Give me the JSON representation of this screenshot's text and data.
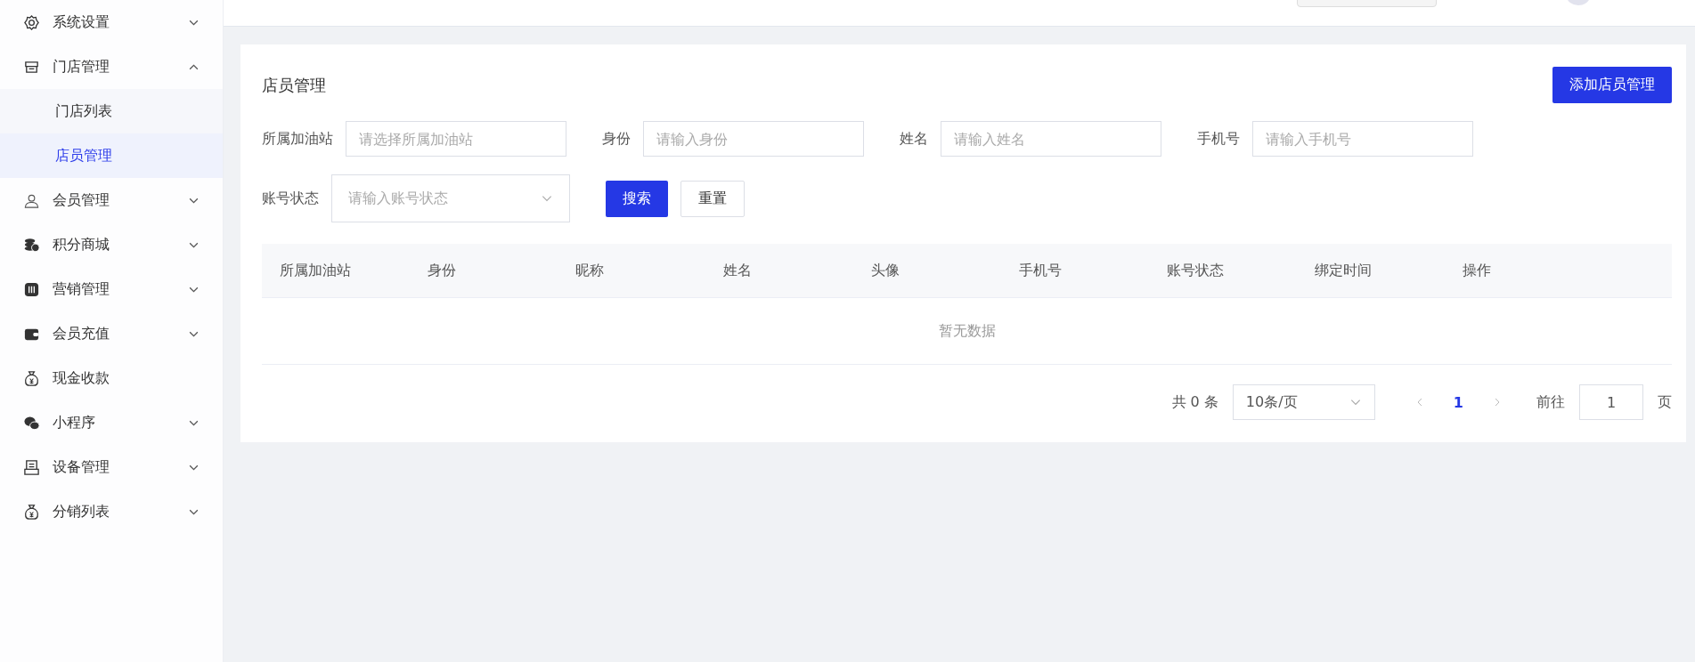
{
  "sidebar": {
    "items": [
      {
        "label": "系统设置",
        "expanded": false
      },
      {
        "label": "门店管理",
        "expanded": true,
        "children": [
          {
            "label": "门店列表",
            "selected": false
          },
          {
            "label": "店员管理",
            "selected": true
          }
        ]
      },
      {
        "label": "会员管理",
        "expanded": false
      },
      {
        "label": "积分商城",
        "expanded": false
      },
      {
        "label": "营销管理",
        "expanded": false
      },
      {
        "label": "会员充值",
        "expanded": false
      },
      {
        "label": "现金收款"
      },
      {
        "label": "小程序",
        "expanded": false
      },
      {
        "label": "设备管理",
        "expanded": false
      },
      {
        "label": "分销列表",
        "expanded": false
      }
    ]
  },
  "page": {
    "title": "店员管理",
    "add_button": "添加店员管理"
  },
  "filters": [
    {
      "label": "所属加油站",
      "placeholder": "请选择所属加油站",
      "kind": "input"
    },
    {
      "label": "身份",
      "placeholder": "请输入身份",
      "kind": "input"
    },
    {
      "label": "姓名",
      "placeholder": "请输入姓名",
      "kind": "input"
    },
    {
      "label": "手机号",
      "placeholder": "请输入手机号",
      "kind": "input"
    },
    {
      "label": "账号状态",
      "placeholder": "请输入账号状态",
      "kind": "select"
    }
  ],
  "actions": {
    "search": "搜索",
    "reset": "重置"
  },
  "table": {
    "columns": [
      "所属加油站",
      "身份",
      "昵称",
      "姓名",
      "头像",
      "手机号",
      "账号状态",
      "绑定时间",
      "操作"
    ],
    "empty_text": "暂无数据"
  },
  "pagination": {
    "total": "共 0 条",
    "page_size": "10条/页",
    "pages": [
      {
        "label": "1",
        "selected": true
      }
    ],
    "goto_label": "前往",
    "goto_value": "1",
    "page_suffix": "页"
  }
}
